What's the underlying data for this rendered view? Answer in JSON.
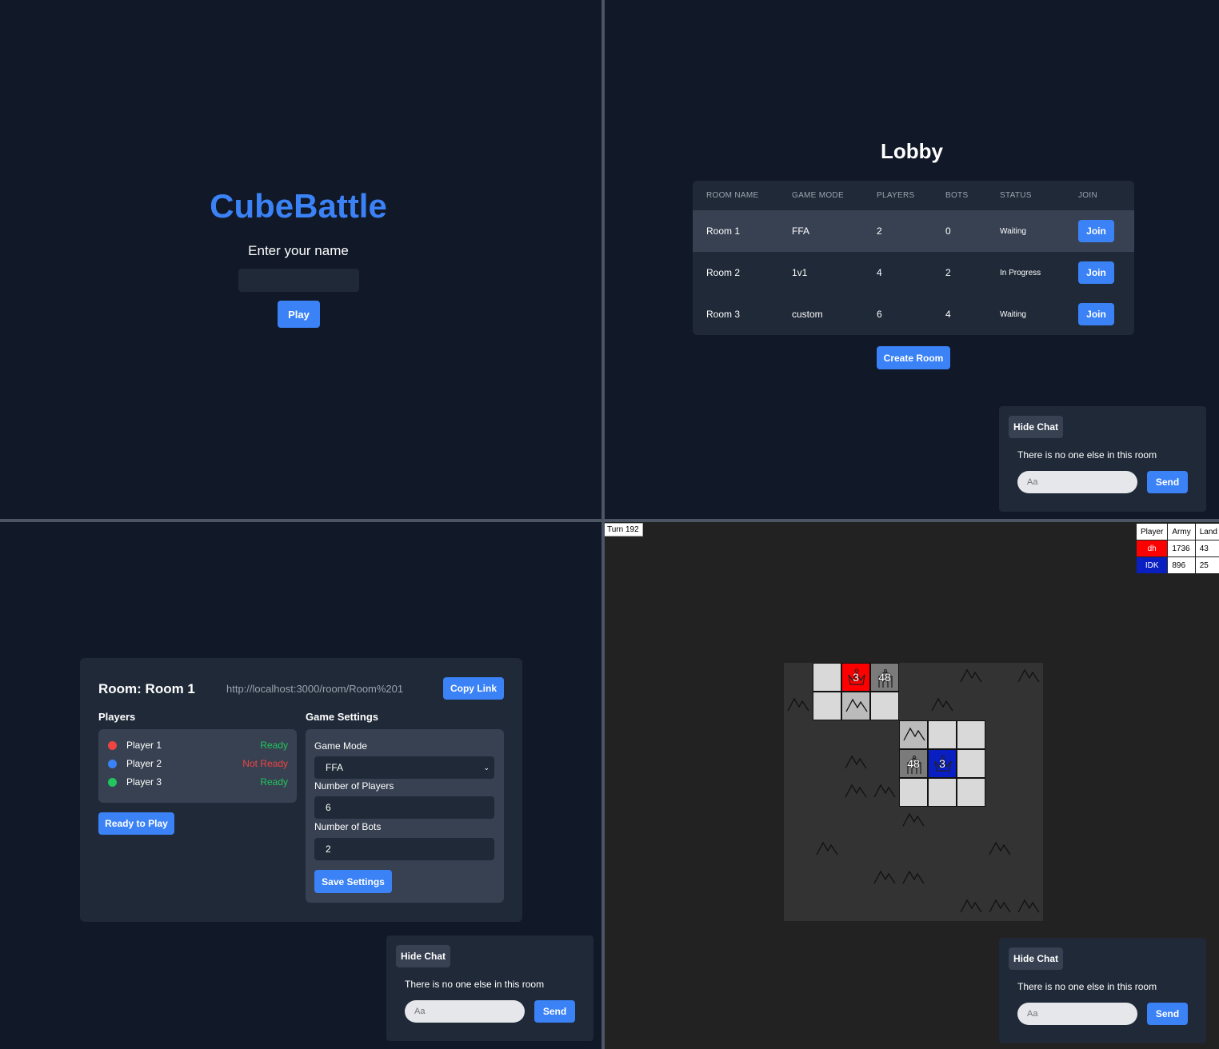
{
  "home": {
    "title": "CubeBattle",
    "prompt": "Enter your name",
    "name_value": "",
    "play": "Play"
  },
  "lobby": {
    "title": "Lobby",
    "headers": [
      "ROOM NAME",
      "GAME MODE",
      "PLAYERS",
      "BOTS",
      "STATUS",
      "JOIN"
    ],
    "rooms": [
      {
        "name": "Room 1",
        "mode": "FFA",
        "players": "2",
        "bots": "0",
        "status": "Waiting",
        "join": "Join"
      },
      {
        "name": "Room 2",
        "mode": "1v1",
        "players": "4",
        "bots": "2",
        "status": "In Progress",
        "join": "Join"
      },
      {
        "name": "Room 3",
        "mode": "custom",
        "players": "6",
        "bots": "4",
        "status": "Waiting",
        "join": "Join"
      }
    ],
    "create": "Create Room"
  },
  "chat": {
    "hide": "Hide Chat",
    "message": "There is no one else in this room",
    "placeholder": "Aa",
    "send": "Send"
  },
  "room": {
    "title": "Room: Room 1",
    "link": "http://localhost:3000/room/Room%201",
    "copy": "Copy Link",
    "players_heading": "Players",
    "settings_heading": "Game Settings",
    "players": [
      {
        "name": "Player 1",
        "status": "Ready",
        "color": "#ef4444",
        "status_color": "#22c55e"
      },
      {
        "name": "Player 2",
        "status": "Not Ready",
        "color": "#3b82f6",
        "status_color": "#ef4444"
      },
      {
        "name": "Player 3",
        "status": "Ready",
        "color": "#22c55e",
        "status_color": "#22c55e"
      }
    ],
    "ready": "Ready to Play",
    "mode_label": "Game Mode",
    "mode_value": "FFA",
    "num_players_label": "Number of Players",
    "num_players_value": "6",
    "num_bots_label": "Number of Bots",
    "num_bots_value": "2",
    "save": "Save Settings"
  },
  "game": {
    "turn": "Turn 192",
    "leaderboard": {
      "headers": [
        "Player",
        "Army",
        "Land"
      ],
      "rows": [
        {
          "player": "dh",
          "army": "1736",
          "land": "43",
          "color": "#ff0000"
        },
        {
          "player": "IDK",
          "army": "896",
          "land": "25",
          "color": "#0a1fc2"
        }
      ]
    },
    "grid_size": 9,
    "cells": [
      {
        "r": 0,
        "c": 1,
        "t": "light"
      },
      {
        "r": 0,
        "c": 2,
        "t": "red",
        "icon": "crown",
        "army": "3"
      },
      {
        "r": 0,
        "c": 3,
        "t": "gray",
        "icon": "city",
        "army": "48"
      },
      {
        "r": 0,
        "c": 6,
        "t": "mountain"
      },
      {
        "r": 0,
        "c": 8,
        "t": "mountain"
      },
      {
        "r": 1,
        "c": 0,
        "t": "mountain"
      },
      {
        "r": 1,
        "c": 1,
        "t": "light"
      },
      {
        "r": 1,
        "c": 2,
        "t": "lightmountain"
      },
      {
        "r": 1,
        "c": 3,
        "t": "light"
      },
      {
        "r": 1,
        "c": 5,
        "t": "mountain"
      },
      {
        "r": 2,
        "c": 4,
        "t": "lightmountain"
      },
      {
        "r": 2,
        "c": 5,
        "t": "light"
      },
      {
        "r": 2,
        "c": 6,
        "t": "light"
      },
      {
        "r": 3,
        "c": 2,
        "t": "mountain"
      },
      {
        "r": 3,
        "c": 4,
        "t": "gray",
        "icon": "city",
        "army": "48"
      },
      {
        "r": 3,
        "c": 5,
        "t": "blue",
        "icon": "crown",
        "army": "3"
      },
      {
        "r": 3,
        "c": 6,
        "t": "light"
      },
      {
        "r": 4,
        "c": 2,
        "t": "mountain"
      },
      {
        "r": 4,
        "c": 3,
        "t": "mountain"
      },
      {
        "r": 4,
        "c": 4,
        "t": "light"
      },
      {
        "r": 4,
        "c": 5,
        "t": "light"
      },
      {
        "r": 4,
        "c": 6,
        "t": "light"
      },
      {
        "r": 5,
        "c": 4,
        "t": "mountain"
      },
      {
        "r": 6,
        "c": 1,
        "t": "mountain"
      },
      {
        "r": 6,
        "c": 7,
        "t": "mountain"
      },
      {
        "r": 7,
        "c": 3,
        "t": "mountain"
      },
      {
        "r": 7,
        "c": 4,
        "t": "mountain"
      },
      {
        "r": 8,
        "c": 6,
        "t": "mountain"
      },
      {
        "r": 8,
        "c": 7,
        "t": "mountain"
      },
      {
        "r": 8,
        "c": 8,
        "t": "mountain"
      }
    ]
  }
}
